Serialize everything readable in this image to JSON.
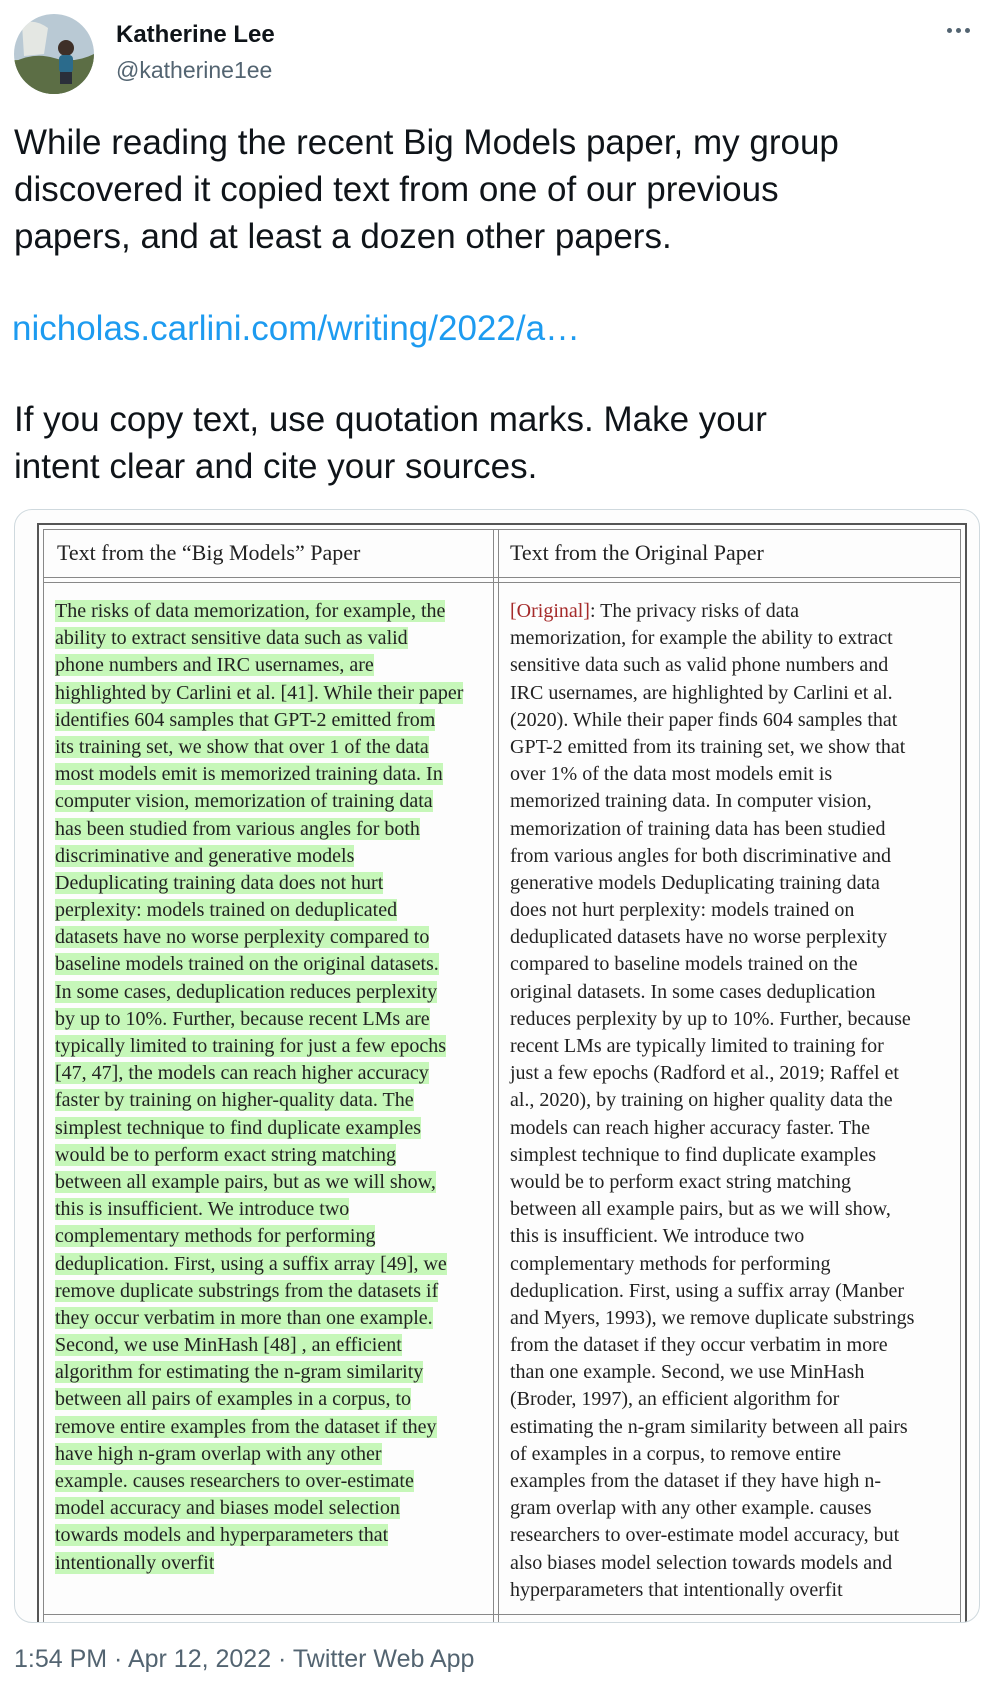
{
  "author": {
    "name": "Katherine Lee",
    "handle": "@katherine1ee"
  },
  "tweet": {
    "paragraph1": [
      "While reading the recent Big Models paper, my group",
      "discovered it copied text from one of our previous",
      "papers, and at least a dozen other papers."
    ],
    "link": "nicholas.carlini.com/writing/2022/a…",
    "paragraph2": [
      "If you copy text, use quotation marks. Make your",
      "intent clear and cite your sources."
    ]
  },
  "table": {
    "left_header": "Text from the “Big Models” Paper",
    "right_header": "Text from the Original Paper",
    "left_lines": [
      "The risks of data memorization, for example, the",
      "ability to extract sensitive data such as valid",
      "phone numbers and IRC usernames, are",
      "highlighted by Carlini et al. [41]. While their paper",
      "identifies 604 samples that GPT-2 emitted from",
      "its training set, we show that over 1 of the data",
      "most models emit is memorized training data. In",
      "computer vision, memorization of training data",
      "has been studied from various angles for both",
      "discriminative and generative models",
      "Deduplicating training data does not hurt",
      "perplexity: models trained on deduplicated",
      "datasets have no worse perplexity compared to",
      "baseline models trained on the original datasets.",
      "In some cases, deduplication reduces perplexity",
      "by up to 10%. Further, because recent LMs are",
      "typically limited to training for just a few epochs",
      "[47, 47], the models can reach higher accuracy",
      "faster by training on higher-quality data. The",
      "simplest technique to find duplicate examples",
      "would be to perform exact string matching",
      "between all example pairs, but as we will show,",
      "this is insufficient. We introduce two",
      "complementary methods for performing",
      "deduplication. First, using a suffix array [49], we",
      "remove duplicate substrings from the datasets if",
      "they occur verbatim in more than one example.",
      "Second, we use MinHash [48] , an efficient",
      "algorithm for estimating the n-gram similarity",
      "between all pairs of examples in a corpus, to",
      "remove entire examples from the dataset if they",
      "have high n-gram overlap with any other",
      "example. causes researchers to over-estimate",
      "model accuracy and biases model selection",
      "towards models and hyperparameters that",
      "intentionally overfit"
    ],
    "right_original_tag": "[Original]",
    "right_lines": [
      ": The privacy risks of data",
      "memorization, for example the ability to extract",
      "sensitive data such as valid phone numbers and",
      "IRC usernames, are highlighted by Carlini et al.",
      "(2020). While their paper finds 604 samples that",
      "GPT-2 emitted from its training set, we show that",
      "over 1% of the data most models emit is",
      "memorized training data. In computer vision,",
      "memorization of training data has been studied",
      "from various angles for both discriminative and",
      "generative models Deduplicating training data",
      "does not hurt perplexity: models trained on",
      "deduplicated datasets have no worse perplexity",
      "compared to baseline models trained on the",
      "original datasets. In some cases deduplication",
      "reduces perplexity by up to 10%. Further, because",
      "recent LMs are typically limited to training for",
      "just a few epochs (Radford et al., 2019; Raffel et",
      "al., 2020), by training on higher quality data the",
      "models can reach higher accuracy faster. The",
      "simplest technique to find duplicate examples",
      "would be to perform exact string matching",
      "between all example pairs, but as we will show,",
      "this is insufficient. We introduce two",
      "complementary methods for performing",
      "deduplication. First, using a suffix array (Manber",
      "and Myers, 1993), we remove duplicate substrings",
      "from the dataset if they occur verbatim in more",
      "than one example. Second, we use MinHash",
      "(Broder, 1997), an efficient algorithm for",
      "estimating the n-gram similarity between all pairs",
      "of examples in a corpus, to remove entire",
      "examples from the dataset if they have high n-",
      "gram overlap with any other example. causes",
      "researchers to over-estimate model accuracy, but",
      "also biases model selection towards models and",
      "hyperparameters that intentionally overfit"
    ]
  },
  "footer": {
    "timestamp": "1:54 PM · Apr 12, 2022 · Twitter Web App"
  },
  "colors": {
    "highlight": "#c6f7b9",
    "link": "#1d9bf0",
    "secondary_text": "#536471",
    "original_tag": "#a52a2a"
  }
}
